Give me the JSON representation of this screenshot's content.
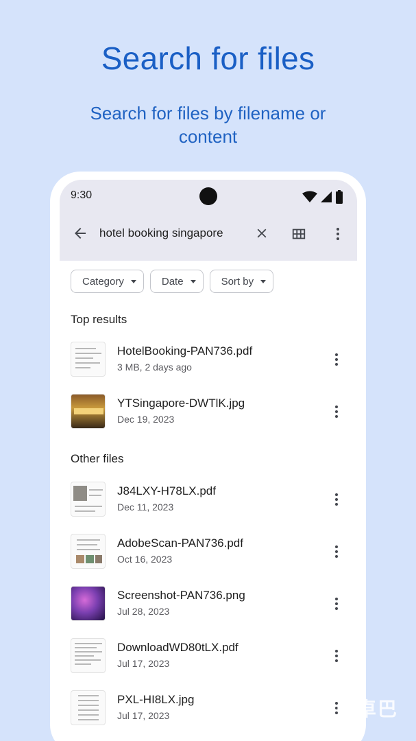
{
  "hero": {
    "title": "Search for files",
    "subtitle": "Search for files by filename or content"
  },
  "status_bar": {
    "time": "9:30",
    "icons": [
      "wifi-icon",
      "signal-icon",
      "battery-icon"
    ]
  },
  "search_bar": {
    "query": "hotel booking singapore",
    "icons": [
      "back-arrow-icon",
      "close-icon",
      "grid-view-icon",
      "more-vert-icon"
    ]
  },
  "filters": [
    {
      "label": "Category"
    },
    {
      "label": "Date"
    },
    {
      "label": "Sort by"
    }
  ],
  "sections": {
    "top_results": "Top results",
    "other_files": "Other files"
  },
  "top_results": [
    {
      "name": "HotelBooking-PAN736.pdf",
      "meta": "3 MB, 2 days ago",
      "thumb": "document"
    },
    {
      "name": "YTSingapore-DWTlK.jpg",
      "meta": "Dec 19, 2023",
      "thumb": "hotel-photo"
    }
  ],
  "other_files": [
    {
      "name": "J84LXY-H78LX.pdf",
      "meta": "Dec 11, 2023",
      "thumb": "document-with-photo"
    },
    {
      "name": "AdobeScan-PAN736.pdf",
      "meta": "Oct 16, 2023",
      "thumb": "scanned-document"
    },
    {
      "name": "Screenshot-PAN736.png",
      "meta": "Jul 28, 2023",
      "thumb": "purple-photo"
    },
    {
      "name": "DownloadWD80tLX.pdf",
      "meta": "Jul 17, 2023",
      "thumb": "document"
    },
    {
      "name": "PXL-HI8LX.jpg",
      "meta": "Jul 17, 2023",
      "thumb": "receipt-photo"
    }
  ],
  "colors": {
    "background": "#d5e3fb",
    "title": "#1a5fc5",
    "topbar": "#e8e8f1"
  },
  "watermark": "安卓巴"
}
